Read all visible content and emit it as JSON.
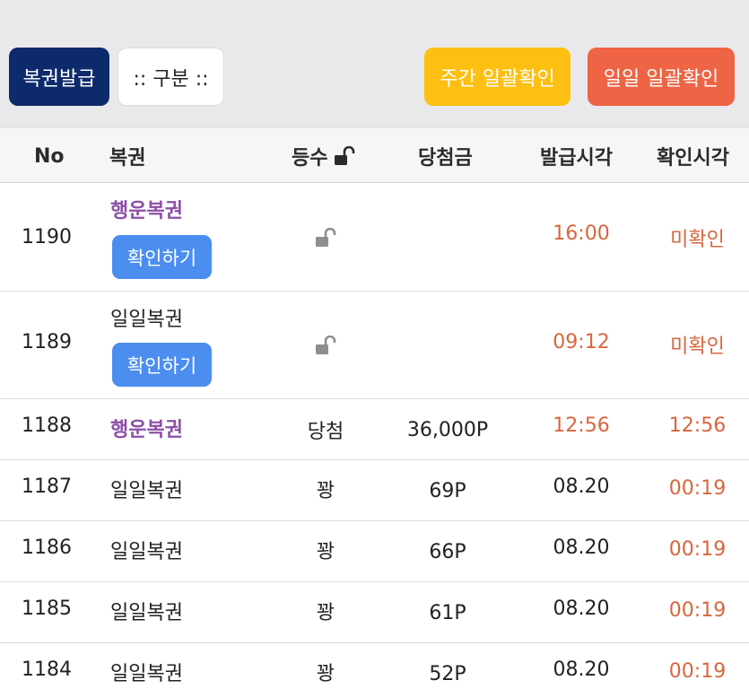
{
  "toolbar": {
    "issue_label": "복권발급",
    "filter_label": ":: 구분 ::",
    "weekly_confirm_label": "주간 일괄확인",
    "daily_confirm_label": "일일 일괄확인"
  },
  "table": {
    "headers": {
      "no": "No",
      "ticket": "복권",
      "rank": "등수",
      "prize": "당첨금",
      "issued": "발급시각",
      "checked": "확인시각"
    },
    "confirm_label": "확인하기",
    "rows": [
      {
        "no": "1190",
        "ticket": "행운복권",
        "rank": "",
        "prize": "",
        "issued": "16:00",
        "checked": "미확인"
      },
      {
        "no": "1189",
        "ticket": "일일복권",
        "rank": "",
        "prize": "",
        "issued": "09:12",
        "checked": "미확인"
      },
      {
        "no": "1188",
        "ticket": "행운복권",
        "rank": "당첨",
        "prize": "36,000P",
        "issued": "12:56",
        "checked": "12:56"
      },
      {
        "no": "1187",
        "ticket": "일일복권",
        "rank": "꽝",
        "prize": "69P",
        "issued": "08.20",
        "checked": "00:19"
      },
      {
        "no": "1186",
        "ticket": "일일복권",
        "rank": "꽝",
        "prize": "66P",
        "issued": "08.20",
        "checked": "00:19"
      },
      {
        "no": "1185",
        "ticket": "일일복권",
        "rank": "꽝",
        "prize": "61P",
        "issued": "08.20",
        "checked": "00:19"
      },
      {
        "no": "1184",
        "ticket": "일일복권",
        "rank": "꽝",
        "prize": "52P",
        "issued": "08.20",
        "checked": "00:19"
      }
    ]
  },
  "colors": {
    "navy": "#0d2a6b",
    "yellow": "#fdbf12",
    "orange": "#ee6444",
    "lucky_purple": "#8c4fa8",
    "time_orange": "#d7663f",
    "confirm_blue": "#4b8ef0"
  },
  "icons": {
    "rank_header": "unlock-icon",
    "row_status": "unlock-icon"
  }
}
